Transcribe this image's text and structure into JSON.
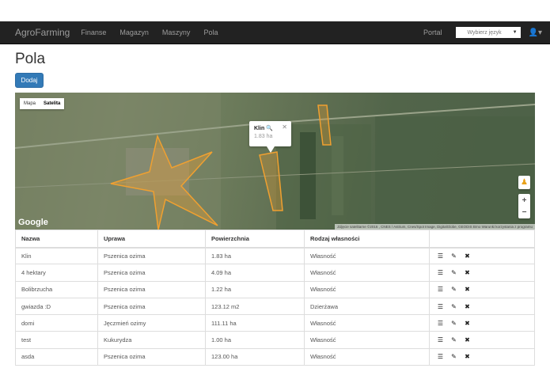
{
  "navbar": {
    "brand": "AgroFarming",
    "links": [
      "Finanse",
      "Magazyn",
      "Maszyny",
      "Pola"
    ],
    "portal": "Portal",
    "language_select": "Wybierz język",
    "user_icon": "user-icon"
  },
  "page": {
    "title": "Pola",
    "add_button": "Dodaj"
  },
  "map": {
    "type_buttons": [
      "Mapa",
      "Satelita"
    ],
    "selected_type": "Satelita",
    "popup": {
      "name": "Klin",
      "area": "1.83 ha"
    },
    "logo": "Google",
    "attribution": "Zdjęcie satelitarne ©2016 , CNES / Astrium, Cnes/Spot Image, DigitalGlobe, GEODIS Brno    Warunki korzystania z programu",
    "zoom_in": "+",
    "zoom_out": "−",
    "field_color": "#f0a030"
  },
  "table": {
    "headers": [
      "Nazwa",
      "Uprawa",
      "Powierzchnia",
      "Rodzaj własności",
      ""
    ],
    "rows": [
      [
        "Klin",
        "Pszenica ozima",
        "1.83 ha",
        "Własność"
      ],
      [
        "4 hektary",
        "Pszenica ozima",
        "4.09 ha",
        "Własność"
      ],
      [
        "Bolibrzucha",
        "Pszenica ozima",
        "1.22 ha",
        "Własność"
      ],
      [
        "gwiazda :D",
        "Pszenica ozima",
        "123.12 m2",
        "Dzierżawa"
      ],
      [
        "domi",
        "Jęczmień ozimy",
        "111.11 ha",
        "Własność"
      ],
      [
        "test",
        "Kukurydza",
        "1.00 ha",
        "Własność"
      ],
      [
        "asda",
        "Pszenica ozima",
        "123.00 ha",
        "Własność"
      ]
    ],
    "actions": [
      "list-icon",
      "edit-icon",
      "delete-icon"
    ]
  }
}
